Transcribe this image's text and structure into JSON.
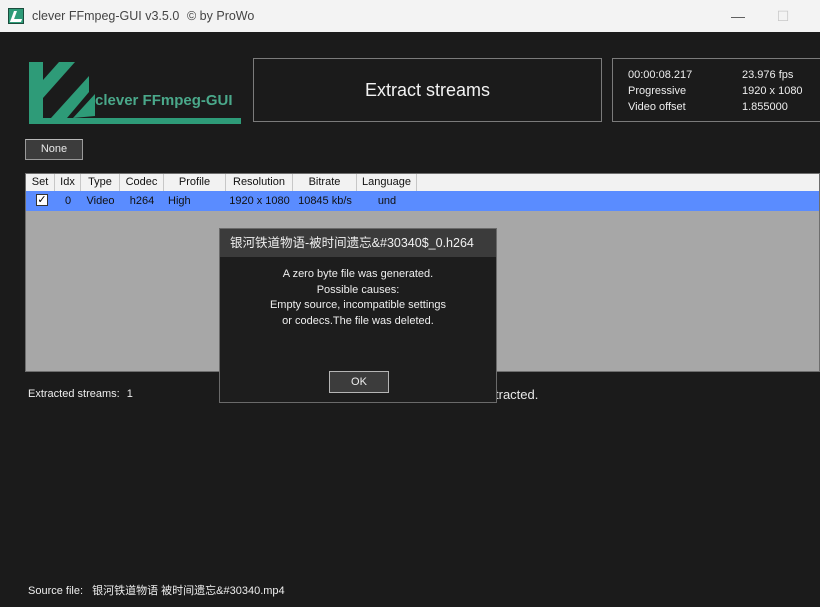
{
  "window": {
    "title": "clever FFmpeg-GUI v3.5.0",
    "byline": "© by ProWo",
    "minimize": "—",
    "maximize": "☐"
  },
  "logo": {
    "text": "clever FFmpeg-GUI"
  },
  "action": {
    "label": "Extract streams"
  },
  "info": {
    "duration": "00:00:08.217",
    "fps": "23.976 fps",
    "scan": "Progressive",
    "resolution": "1920 x 1080",
    "offset_label": "Video offset",
    "offset_value": "1.855000"
  },
  "buttons": {
    "none_label": "None"
  },
  "table": {
    "columns": [
      "Set",
      "Idx",
      "Type",
      "Codec",
      "Profile",
      "Resolution",
      "Bitrate",
      "Language"
    ],
    "rows": [
      {
        "set": "✓",
        "idx": "0",
        "type": "Video",
        "codec": "h264",
        "profile": "High",
        "resolution": "1920 x 1080",
        "bitrate": "10845 kb/s",
        "language": "und"
      }
    ]
  },
  "status": {
    "extracted_label": "Extracted streams:",
    "extracted_count": "1",
    "tail_text": "tracted.",
    "source_label": "Source file:",
    "source_value": "银河铁道物语 被时间遗忘&#30340.mp4"
  },
  "dialog": {
    "title": "银河铁道物语-被时间遗忘&#30340$_0.h264",
    "lines": [
      "A zero byte file was generated.",
      "Possible causes:",
      "Empty source, incompatible settings",
      "or codecs.The file was deleted."
    ],
    "ok_label": "OK"
  },
  "colors": {
    "background": "#1b1b1b",
    "selection": "#5a8cff",
    "logo_green": "#2e9b78"
  }
}
